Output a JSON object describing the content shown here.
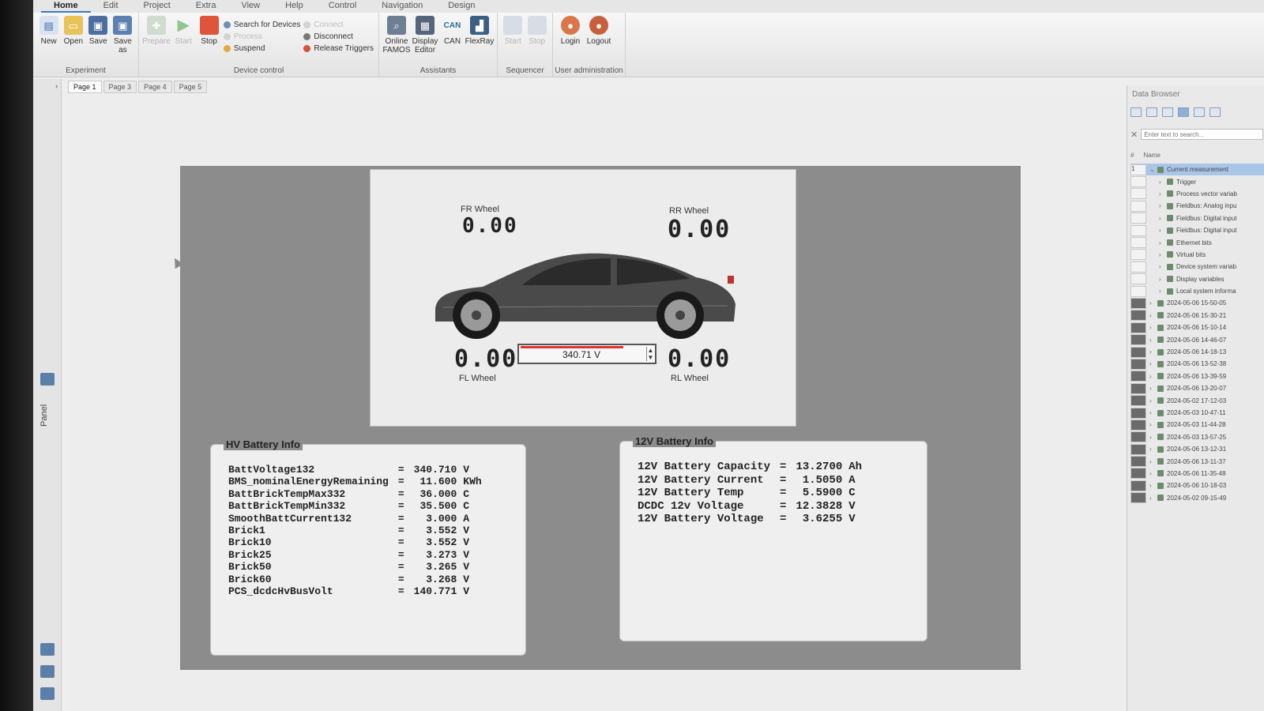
{
  "menu": [
    "Home",
    "Edit",
    "Project",
    "Extra",
    "View",
    "Help",
    "Control",
    "Navigation",
    "Design"
  ],
  "ribbon": {
    "experiment": {
      "label": "Experiment",
      "buttons": [
        {
          "label": "New",
          "icon": "new-file-icon"
        },
        {
          "label": "Open",
          "icon": "folder-icon"
        },
        {
          "label": "Save",
          "icon": "save-icon"
        },
        {
          "label": "Save as",
          "icon": "save-as-icon"
        }
      ]
    },
    "device_control": {
      "label": "Device control",
      "buttons": [
        {
          "label": "Prepare",
          "icon": "prepare-icon",
          "disabled": true
        },
        {
          "label": "Start",
          "icon": "play-icon",
          "disabled": true
        },
        {
          "label": "Stop",
          "icon": "stop-icon"
        }
      ],
      "list1": [
        {
          "label": "Search for Devices",
          "disabled": false
        },
        {
          "label": "Process",
          "disabled": true
        },
        {
          "label": "Suspend",
          "disabled": false
        }
      ],
      "list2": [
        {
          "label": "Connect",
          "disabled": true
        },
        {
          "label": "Disconnect",
          "disabled": false
        },
        {
          "label": "Release Triggers",
          "disabled": false
        }
      ]
    },
    "assistants": {
      "label": "Assistants",
      "buttons": [
        {
          "label": "Online FAMOS",
          "icon": "famos-icon"
        },
        {
          "label": "Display Editor",
          "icon": "display-editor-icon"
        },
        {
          "label": "CAN",
          "icon": "can-icon"
        },
        {
          "label": "FlexRay",
          "icon": "flexray-icon"
        }
      ]
    },
    "sequencer": {
      "label": "Sequencer",
      "buttons": [
        {
          "label": "Start",
          "icon": "seq-start-icon",
          "disabled": true
        },
        {
          "label": "Stop",
          "icon": "seq-stop-icon",
          "disabled": true
        }
      ]
    },
    "user_admin": {
      "label": "User administration",
      "buttons": [
        {
          "label": "Login",
          "icon": "login-icon"
        },
        {
          "label": "Logout",
          "icon": "logout-icon"
        }
      ]
    }
  },
  "tabs": [
    "Page 1",
    "Page 3",
    "Page 4",
    "Page 5"
  ],
  "panel_label": "Panel",
  "car": {
    "fr_label": "FR Wheel",
    "fr_value": "0.00",
    "rr_label": "RR Wheel",
    "rr_value": "0.00",
    "fl_label": "FL Wheel",
    "fl_value": "0.00",
    "rl_label": "RL Wheel",
    "rl_value": "0.00",
    "voltage": "340.71 V"
  },
  "hv": {
    "title": "HV Battery Info",
    "rows": [
      {
        "name": "BattVoltage132",
        "value": "340.710",
        "unit": "V"
      },
      {
        "name": "BMS_nominalEnergyRemaining",
        "value": "11.600",
        "unit": "KWh"
      },
      {
        "name": "BattBrickTempMax332",
        "value": "36.000",
        "unit": "C"
      },
      {
        "name": "BattBrickTempMin332",
        "value": "35.500",
        "unit": "C"
      },
      {
        "name": "SmoothBattCurrent132",
        "value": "3.000",
        "unit": "A"
      },
      {
        "name": "Brick1",
        "value": "3.552",
        "unit": "V"
      },
      {
        "name": "Brick10",
        "value": "3.552",
        "unit": "V"
      },
      {
        "name": "Brick25",
        "value": "3.273",
        "unit": "V"
      },
      {
        "name": "Brick50",
        "value": "3.265",
        "unit": "V"
      },
      {
        "name": "Brick60",
        "value": "3.268",
        "unit": "V"
      },
      {
        "name": "PCS_dcdcHvBusVolt",
        "value": "140.771",
        "unit": "V"
      }
    ]
  },
  "lv": {
    "title": "12V Battery Info",
    "rows": [
      {
        "name": "12V Battery Capacity",
        "value": "13.2700",
        "unit": "Ah"
      },
      {
        "name": "12V Battery Current",
        "value": "1.5050",
        "unit": "A"
      },
      {
        "name": "12V Battery Temp",
        "value": "5.5900",
        "unit": "C"
      },
      {
        "name": "DCDC 12v Voltage",
        "value": "12.3828",
        "unit": "V"
      },
      {
        "name": "12V Battery Voltage",
        "value": "3.6255",
        "unit": "V"
      }
    ]
  },
  "browser": {
    "title": "Data Browser",
    "search_placeholder": "Enter text to search...",
    "col_num": "#",
    "col_name": "Name",
    "tree": [
      {
        "label": "Current measurement",
        "level": 0,
        "num": "1",
        "selected": true,
        "open": true
      },
      {
        "label": "Trigger",
        "level": 1
      },
      {
        "label": "Process vector variab",
        "level": 1
      },
      {
        "label": "Fieldbus: Analog inpu",
        "level": 1
      },
      {
        "label": "Fieldbus: Digital input",
        "level": 1
      },
      {
        "label": "Fieldbus: Digital input",
        "level": 1
      },
      {
        "label": "Ethernet bits",
        "level": 1
      },
      {
        "label": "Virtual bits",
        "level": 1
      },
      {
        "label": "Device system variab",
        "level": 1
      },
      {
        "label": "Display variables",
        "level": 1
      },
      {
        "label": "Local system informa",
        "level": 1
      },
      {
        "label": "2024-05-06 15-50-05",
        "level": 0,
        "dark": true
      },
      {
        "label": "2024-05-06 15-30-21",
        "level": 0,
        "dark": true
      },
      {
        "label": "2024-05-06 15-10-14",
        "level": 0,
        "dark": true
      },
      {
        "label": "2024-05-06 14-46-07",
        "level": 0,
        "dark": true
      },
      {
        "label": "2024-05-06 14-18-13",
        "level": 0,
        "dark": true
      },
      {
        "label": "2024-05-06 13-52-38",
        "level": 0,
        "dark": true
      },
      {
        "label": "2024-05-06 13-39-59",
        "level": 0,
        "dark": true
      },
      {
        "label": "2024-05-06 13-20-07",
        "level": 0,
        "dark": true
      },
      {
        "label": "2024-05-02 17-12-03",
        "level": 0,
        "dark": true
      },
      {
        "label": "2024-05-03 10-47-11",
        "level": 0,
        "dark": true
      },
      {
        "label": "2024-05-03 11-44-28",
        "level": 0,
        "dark": true
      },
      {
        "label": "2024-05-03 13-57-25",
        "level": 0,
        "dark": true
      },
      {
        "label": "2024-05-06 13-12-31",
        "level": 0,
        "dark": true
      },
      {
        "label": "2024-05-06 13-11-37",
        "level": 0,
        "dark": true
      },
      {
        "label": "2024-05-06 11-35-48",
        "level": 0,
        "dark": true
      },
      {
        "label": "2024-05-06 10-18-03",
        "level": 0,
        "dark": true
      },
      {
        "label": "2024-05-02 09-15-49",
        "level": 0,
        "dark": true
      }
    ]
  },
  "colors": {
    "accent": "#3a78c2",
    "display_bg": "#8c8c8c",
    "selection": "#a9c6e8",
    "voltage_bar": "#dd3333"
  }
}
